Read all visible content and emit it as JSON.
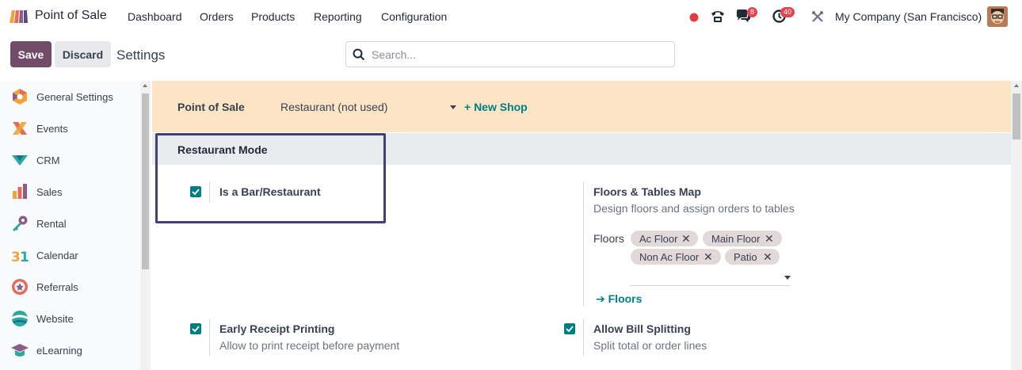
{
  "app": {
    "name": "Point of Sale",
    "brand_color": "#714b67",
    "accent_color": "#017e84"
  },
  "nav": {
    "items": [
      "Dashboard",
      "Orders",
      "Products",
      "Reporting",
      "Configuration"
    ]
  },
  "systray": {
    "chat_count": "8",
    "activity_count": "40",
    "company": "My Company (San Francisco)"
  },
  "control": {
    "save_label": "Save",
    "discard_label": "Discard",
    "title": "Settings",
    "search_placeholder": "Search..."
  },
  "sidebar": {
    "items": [
      {
        "label": "General Settings",
        "icon": "general-settings-icon"
      },
      {
        "label": "Events",
        "icon": "events-icon"
      },
      {
        "label": "CRM",
        "icon": "crm-icon"
      },
      {
        "label": "Sales",
        "icon": "sales-icon"
      },
      {
        "label": "Rental",
        "icon": "rental-icon"
      },
      {
        "label": "Calendar",
        "icon": "calendar-icon"
      },
      {
        "label": "Referrals",
        "icon": "referrals-icon"
      },
      {
        "label": "Website",
        "icon": "website-icon"
      },
      {
        "label": "eLearning",
        "icon": "elearning-icon"
      }
    ]
  },
  "pos_bar": {
    "label": "Point of Sale",
    "selected_shop": "Restaurant (not used)",
    "new_shop_label": "+ New Shop"
  },
  "section": {
    "title": "Restaurant Mode"
  },
  "options": {
    "bar_restaurant": {
      "title": "Is a Bar/Restaurant",
      "checked": true
    },
    "floors_map": {
      "title": "Floors & Tables Map",
      "desc": "Design floors and assign orders to tables"
    },
    "floors": {
      "label": "Floors",
      "tags": [
        "Ac Floor",
        "Main Floor",
        "Non Ac Floor",
        "Patio"
      ],
      "link_label": "Floors"
    },
    "early_receipt": {
      "title": "Early Receipt Printing",
      "desc": "Allow to print receipt before payment",
      "checked": true
    },
    "bill_splitting": {
      "title": "Allow Bill Splitting",
      "desc": "Split total or order lines",
      "checked": true
    }
  }
}
